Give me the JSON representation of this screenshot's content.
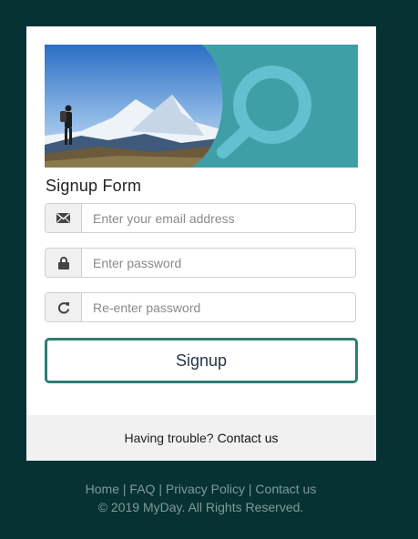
{
  "form": {
    "title": "Signup Form",
    "email": {
      "placeholder": "Enter your email address",
      "icon": "envelope-icon"
    },
    "password": {
      "placeholder": "Enter password",
      "icon": "lock-icon"
    },
    "confirm_password": {
      "placeholder": "Re-enter password",
      "icon": "refresh-icon"
    },
    "submit_label": "Signup"
  },
  "help": {
    "text": "Having trouble?",
    "link": "Contact us"
  },
  "footer": {
    "links": [
      "Home",
      "FAQ",
      "Privacy Policy",
      "Contact us"
    ],
    "separator": "|",
    "copyright": "© 2019 MyDay. All Rights Reserved."
  },
  "colors": {
    "page_background": "#073233",
    "accent": "#2f7d76",
    "banner_teal": "#3e9fa7"
  }
}
